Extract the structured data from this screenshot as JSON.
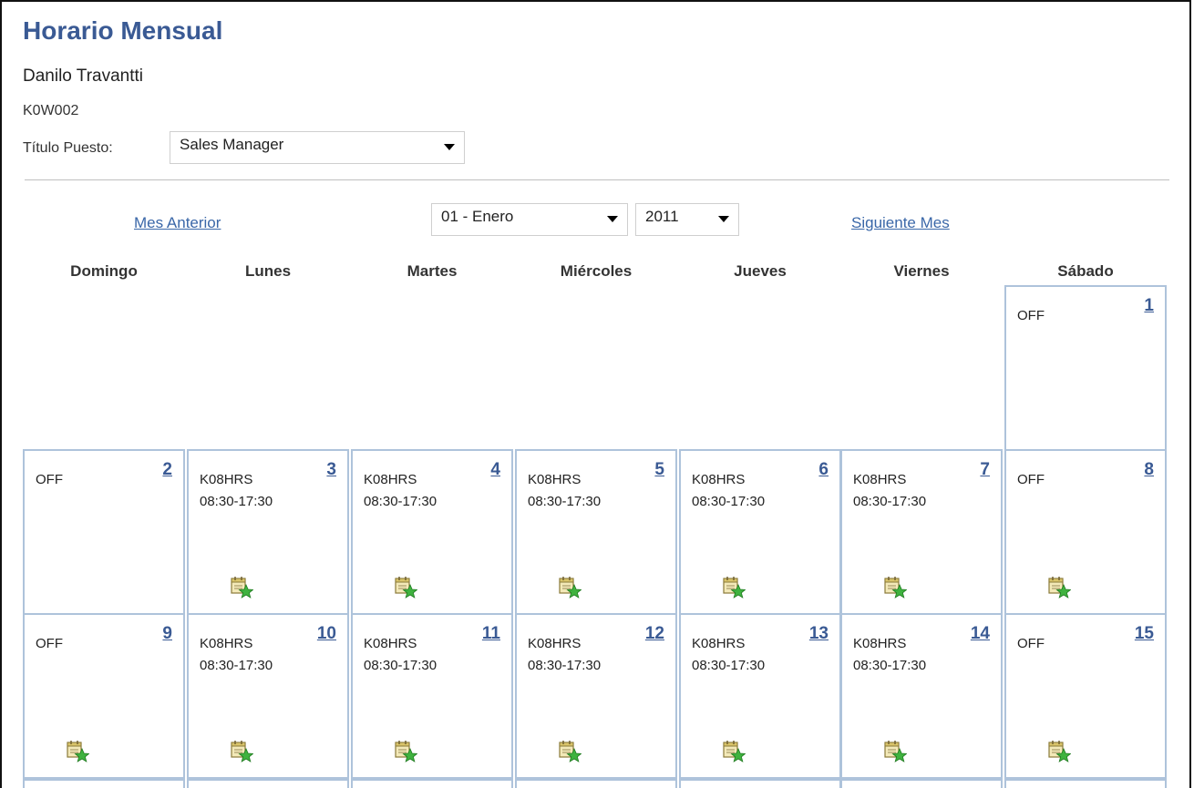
{
  "page": {
    "title": "Horario Mensual",
    "employee_name": "Danilo Travantti",
    "employee_id": "K0W002",
    "job_title_label": "Título Puesto:",
    "job_title_value": "Sales Manager"
  },
  "navigation": {
    "prev_label": "Mes Anterior",
    "next_label": "Siguiente Mes",
    "month_value": "01 - Enero",
    "year_value": "2011"
  },
  "weekdays": [
    "Domingo",
    "Lunes",
    "Martes",
    "Miércoles",
    "Jueves",
    "Viernes",
    "Sábado"
  ],
  "calendar": [
    {
      "day": "1",
      "lines": [
        "OFF"
      ],
      "icon": false
    },
    {
      "day": "2",
      "lines": [
        "OFF"
      ],
      "icon": false
    },
    {
      "day": "3",
      "lines": [
        "K08HRS",
        "08:30-17:30"
      ],
      "icon": true
    },
    {
      "day": "4",
      "lines": [
        "K08HRS",
        "08:30-17:30"
      ],
      "icon": true
    },
    {
      "day": "5",
      "lines": [
        "K08HRS",
        "08:30-17:30"
      ],
      "icon": true
    },
    {
      "day": "6",
      "lines": [
        "K08HRS",
        "08:30-17:30"
      ],
      "icon": true
    },
    {
      "day": "7",
      "lines": [
        "K08HRS",
        "08:30-17:30"
      ],
      "icon": true
    },
    {
      "day": "8",
      "lines": [
        "OFF"
      ],
      "icon": true
    },
    {
      "day": "9",
      "lines": [
        "OFF"
      ],
      "icon": true
    },
    {
      "day": "10",
      "lines": [
        "K08HRS",
        "08:30-17:30"
      ],
      "icon": true
    },
    {
      "day": "11",
      "lines": [
        "K08HRS",
        "08:30-17:30"
      ],
      "icon": true
    },
    {
      "day": "12",
      "lines": [
        "K08HRS",
        "08:30-17:30"
      ],
      "icon": true
    },
    {
      "day": "13",
      "lines": [
        "K08HRS",
        "08:30-17:30"
      ],
      "icon": true
    },
    {
      "day": "14",
      "lines": [
        "K08HRS",
        "08:30-17:30"
      ],
      "icon": true
    },
    {
      "day": "15",
      "lines": [
        "OFF"
      ],
      "icon": true
    }
  ],
  "icons": {
    "cell_action_icon": "calendar-add-icon",
    "dropdown_icon": "chevron-down-icon"
  },
  "colors": {
    "title": "#3a5a94",
    "link": "#3a67a8",
    "cell_border": "#aec3db"
  }
}
